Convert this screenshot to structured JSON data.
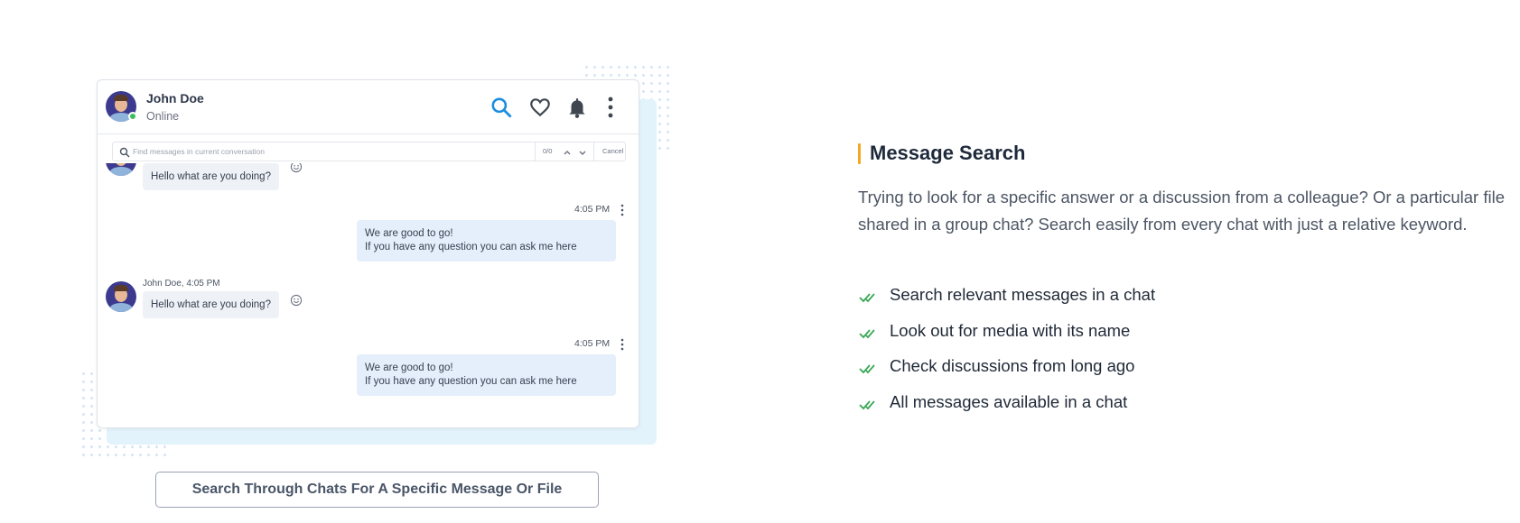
{
  "chat": {
    "contact_name": "John Doe",
    "contact_status": "Online",
    "search": {
      "placeholder": "Find messages in current conversation",
      "count": "0/0",
      "cancel_label": "Cancel"
    },
    "messages": [
      {
        "type": "incoming",
        "text": "Hello what are you doing?"
      },
      {
        "type": "outgoing",
        "time": "4:05 PM",
        "lines": [
          "We are good to go!",
          "If you have any question you can ask me here"
        ]
      },
      {
        "type": "incoming",
        "meta": "John Doe, 4:05 PM",
        "text": "Hello what are you doing?"
      },
      {
        "type": "outgoing",
        "time": "4:05 PM",
        "lines": [
          "We are good to go!",
          "If you have any question you can ask me here"
        ]
      }
    ],
    "icons": {
      "search": "search-icon",
      "favorite": "heart-icon",
      "notifications": "bell-icon",
      "more": "more-vertical-icon"
    }
  },
  "caption": "Search Through Chats For A Specific Message Or File",
  "feature": {
    "title": "Message Search",
    "description": "Trying to look for a specific answer or a discussion from a colleague? Or a particular file shared in a group chat? Search easily from every chat with just a relative keyword.",
    "items": [
      {
        "label": "Search relevant messages in a chat",
        "icon": "double-check-icon"
      },
      {
        "label": "Look out for media with its name",
        "icon": "double-check-icon"
      },
      {
        "label": "Check discussions from long ago",
        "icon": "double-check-icon"
      },
      {
        "label": "All messages available in a chat",
        "icon": "double-check-icon"
      }
    ]
  },
  "colors": {
    "accent": "#f5a623",
    "brand_blue": "#1c8ddf",
    "check_green": "#3aa858",
    "online_green": "#3bbf5a"
  }
}
